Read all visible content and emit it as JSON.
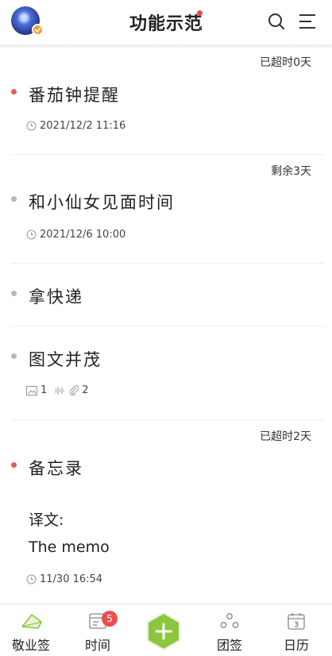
{
  "header": {
    "title": "功能示范",
    "avatar_icon": "avatar-icon",
    "search_icon": "search-icon",
    "menu_icon": "menu-icon"
  },
  "items": [
    {
      "status": "已超时0天",
      "title": "番茄钟提醒",
      "datetime": "2021/12/2  11:16",
      "dot": "red"
    },
    {
      "status": "剩余3天",
      "title": "和小仙女见面时间",
      "datetime": "2021/12/6  10:00",
      "dot": "gray"
    },
    {
      "title": "拿快递",
      "dot": "gray"
    },
    {
      "title": "图文并茂",
      "images": "1",
      "attachments": "2",
      "dot": "gray"
    },
    {
      "status": "已超时2天",
      "title": "备忘录",
      "body_line1": "译文:",
      "body_line2": "The memo",
      "datetime": "11/30  16:54",
      "dot": "red"
    }
  ],
  "tabbar": {
    "tab1": "敬业签",
    "tab2": "时间",
    "tab2_badge": "5",
    "tab4": "团签",
    "tab5": "日历",
    "calendar_day": "3"
  },
  "colors": {
    "accent_green": "#8cc63f",
    "overdue_dot": "#e85a5a",
    "badge_red": "#e85050"
  }
}
